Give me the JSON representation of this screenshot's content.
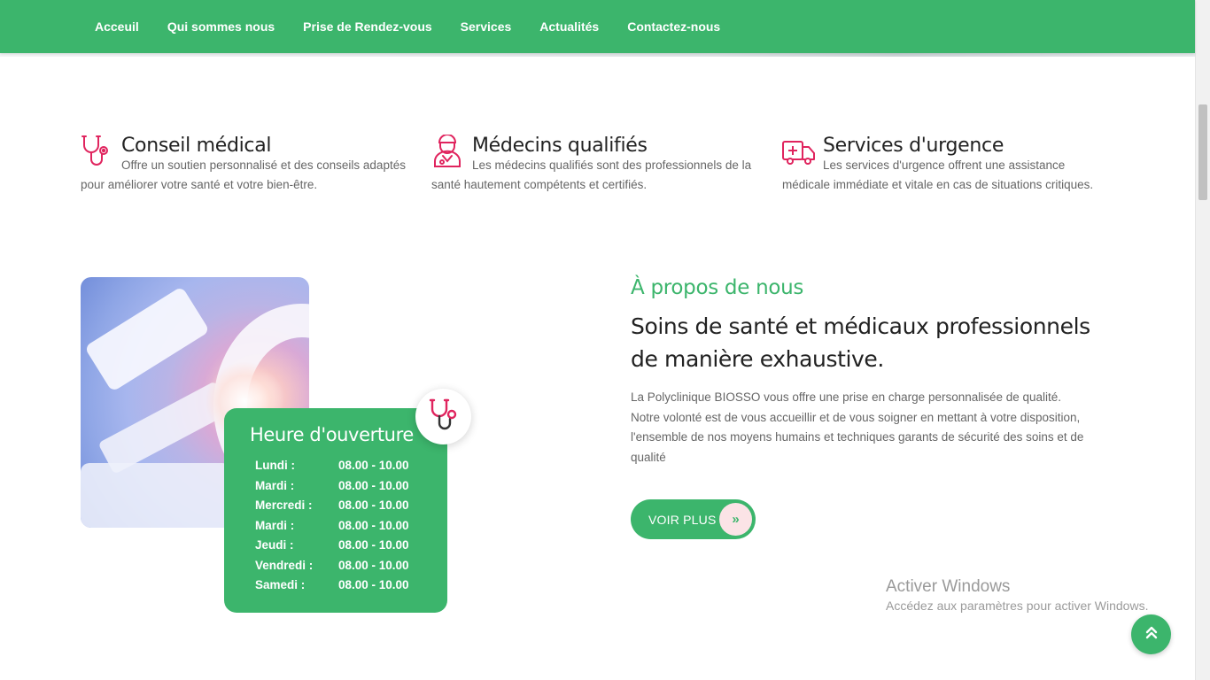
{
  "nav": {
    "items": [
      "Acceuil",
      "Qui sommes nous",
      "Prise de Rendez-vous",
      "Services",
      "Actualités",
      "Contactez-nous"
    ]
  },
  "features": [
    {
      "icon": "stethoscope-icon",
      "title": "Conseil médical",
      "text": "Offre un soutien personnalisé et des conseils adaptés pour améliorer votre santé et votre bien-être."
    },
    {
      "icon": "doctor-icon",
      "title": "Médecins qualifiés",
      "text": "Les médecins qualifiés sont des professionnels de la santé hautement compétents et certifiés."
    },
    {
      "icon": "ambulance-icon",
      "title": "Services d'urgence",
      "text": "Les services d'urgence offrent une assistance médicale immédiate et vitale en cas de situations critiques."
    }
  ],
  "hours": {
    "title": "Heure d'ouverture",
    "rows": [
      {
        "day": "Lundi :",
        "time": "08.00 - 10.00"
      },
      {
        "day": "Mardi :",
        "time": "08.00 - 10.00"
      },
      {
        "day": "Mercredi :",
        "time": "08.00 - 10.00"
      },
      {
        "day": "Mardi :",
        "time": "08.00 - 10.00"
      },
      {
        "day": "Jeudi :",
        "time": "08.00 - 10.00"
      },
      {
        "day": "Vendredi :",
        "time": "08.00 - 10.00"
      },
      {
        "day": "Samedi :",
        "time": "08.00 - 10.00"
      }
    ]
  },
  "about": {
    "subtitle": "À propos de nous",
    "title": "Soins de santé et médicaux professionnels de manière exhaustive.",
    "text": "La Polyclinique BIOSSO vous offre une prise en charge personnalisée de qualité. Notre volonté est de vous accueillir et de vous soigner en mettant à votre disposition, l'ensemble de nos moyens humains et techniques garants de sécurité des soins et de qualité",
    "button_label": "VOIR PLUS",
    "button_icon": "»"
  },
  "watermark": {
    "title": "Activer Windows",
    "subtitle": "Accédez aux paramètres pour activer Windows."
  },
  "back_to_top_icon": "chevrons-up-icon",
  "colors": {
    "primary": "#3cb56c",
    "accent": "#e0245e",
    "text": "#222222",
    "muted": "#666666"
  }
}
